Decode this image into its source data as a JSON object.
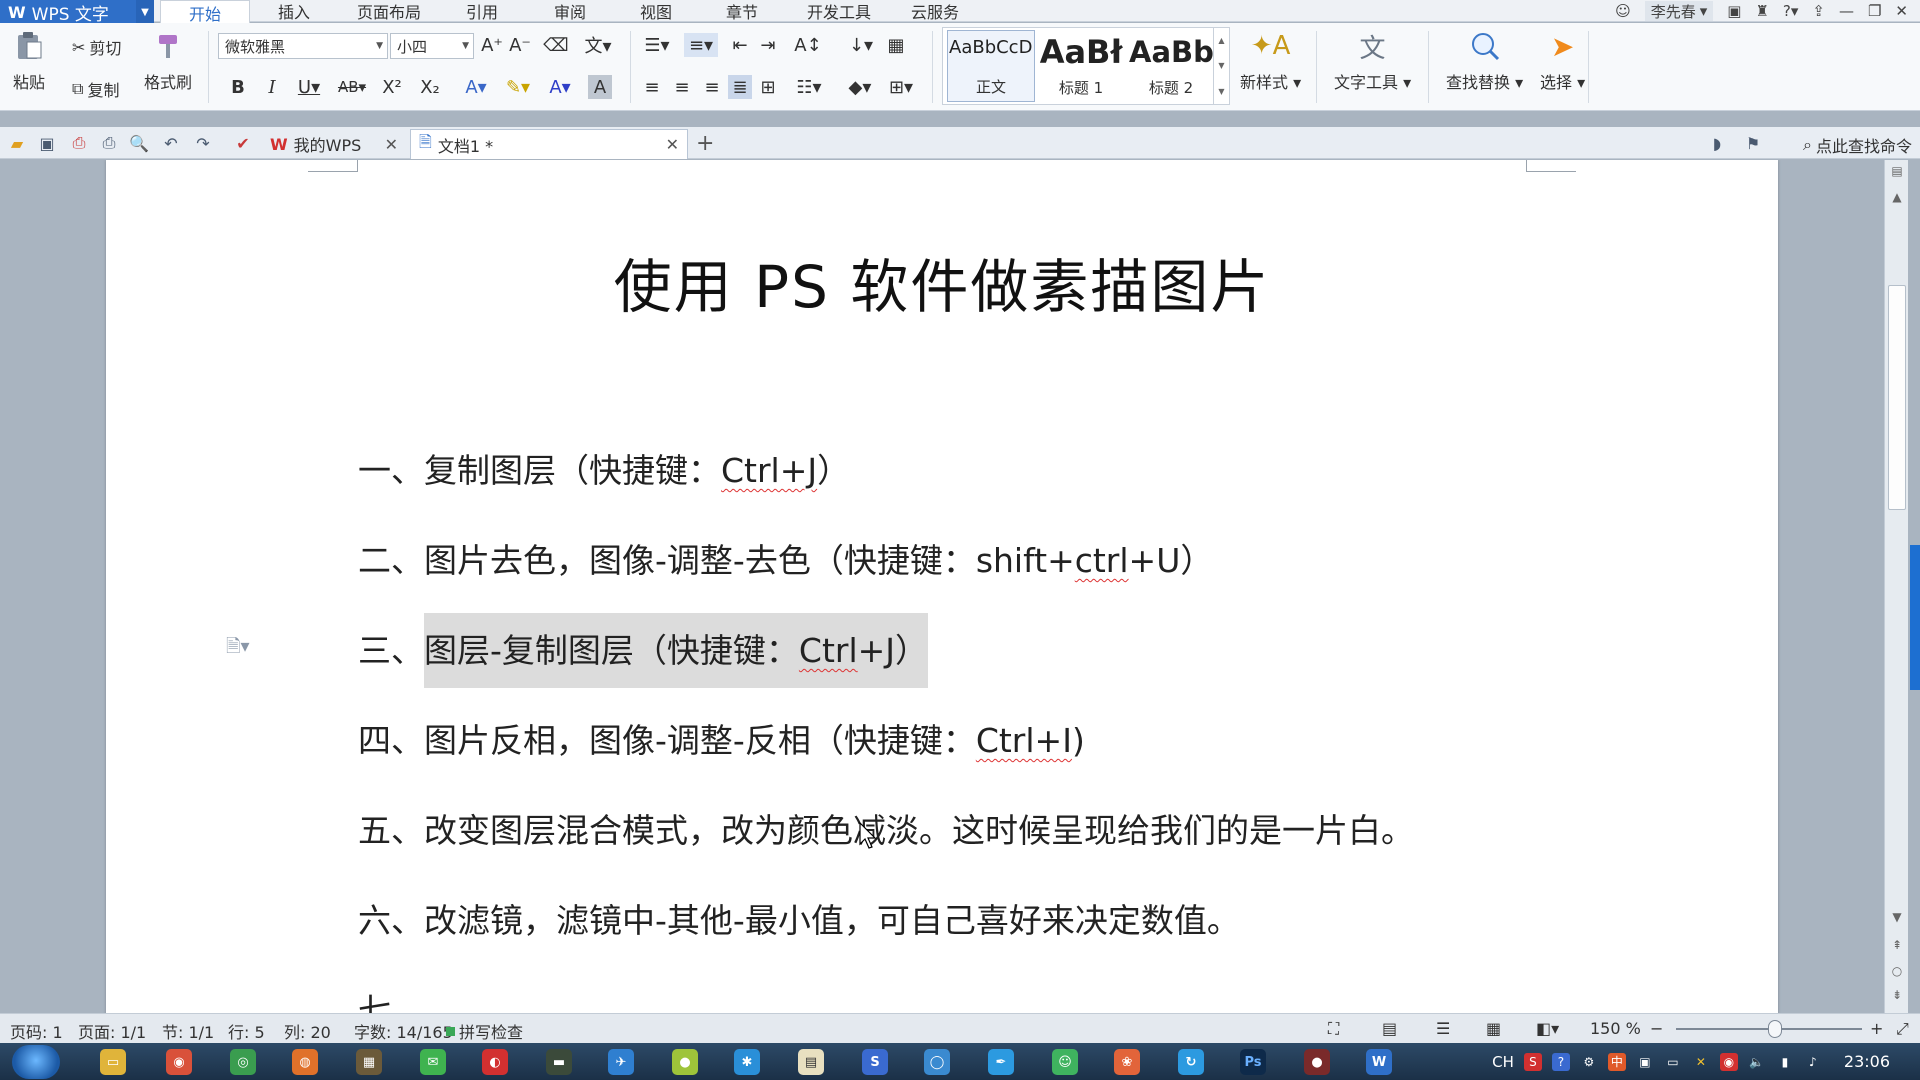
{
  "app": {
    "name": "WPS 文字",
    "logo_letter": "W"
  },
  "ribbon_tabs": [
    "开始",
    "插入",
    "页面布局",
    "引用",
    "审阅",
    "视图",
    "章节",
    "开发工具",
    "云服务"
  ],
  "active_tab": "开始",
  "user": {
    "name": "李先春"
  },
  "ribbon": {
    "paste": "粘贴",
    "cut": "剪切",
    "copy": "复制",
    "format_painter": "格式刷",
    "font_name": "微软雅黑",
    "font_size": "小四",
    "styles": [
      {
        "sample": "AaBbCcDd",
        "name": "正文"
      },
      {
        "sample": "AaBł",
        "name": "标题 1"
      },
      {
        "sample": "AaBb(",
        "name": "标题 2"
      }
    ],
    "new_style": "新样式",
    "text_tools": "文字工具",
    "find_replace": "查找替换",
    "select": "选择"
  },
  "doc_tabs": [
    {
      "label": "我的WPS"
    },
    {
      "label": "文档1 *"
    }
  ],
  "find_command": "点此查找命令",
  "document": {
    "title": "使用 PS 软件做素描图片",
    "lines": [
      {
        "num": "一、",
        "text": "复制图层（快捷键：",
        "key": "Ctrl+J",
        "tail": "）"
      },
      {
        "num": "二、",
        "text": "图片去色，图像-调整-去色（快捷键：shift+",
        "key": "ctrl",
        "tail": "+U）"
      },
      {
        "num": "三、",
        "text": "图层-复制图层（快捷键：",
        "key": "Ctrl",
        "tail": "+J）"
      },
      {
        "num": "四、",
        "text": "图片反相，图像-调整-反相（快捷键：",
        "key": "Ctrl+I",
        "tail": ")"
      },
      {
        "num": "五、",
        "text": "改变图层混合模式，改为颜色减淡。这时候呈现给我们的是一片白。",
        "key": "",
        "tail": ""
      },
      {
        "num": "六、",
        "text": "改滤镜，滤镜中-其他-最小值，可自己喜好来决定数值。",
        "key": "",
        "tail": ""
      },
      {
        "num": "七、",
        "text": "",
        "key": "",
        "tail": ""
      }
    ]
  },
  "status": {
    "page_num": "页码: 1",
    "pages": "页面: 1/1",
    "section": "节: 1/1",
    "row": "行: 5",
    "col": "列: 20",
    "words": "字数: 14/165",
    "spell_check": "拼写检查",
    "zoom": "150 %",
    "zoom_level": 0.5
  },
  "taskbar": {
    "clock": "23:06",
    "ime": "CH",
    "ime_mode": "中"
  },
  "colors": {
    "accent": "#2f6fc8",
    "highlight": "#dcdcdc",
    "spell_underline": "#dd3333"
  }
}
